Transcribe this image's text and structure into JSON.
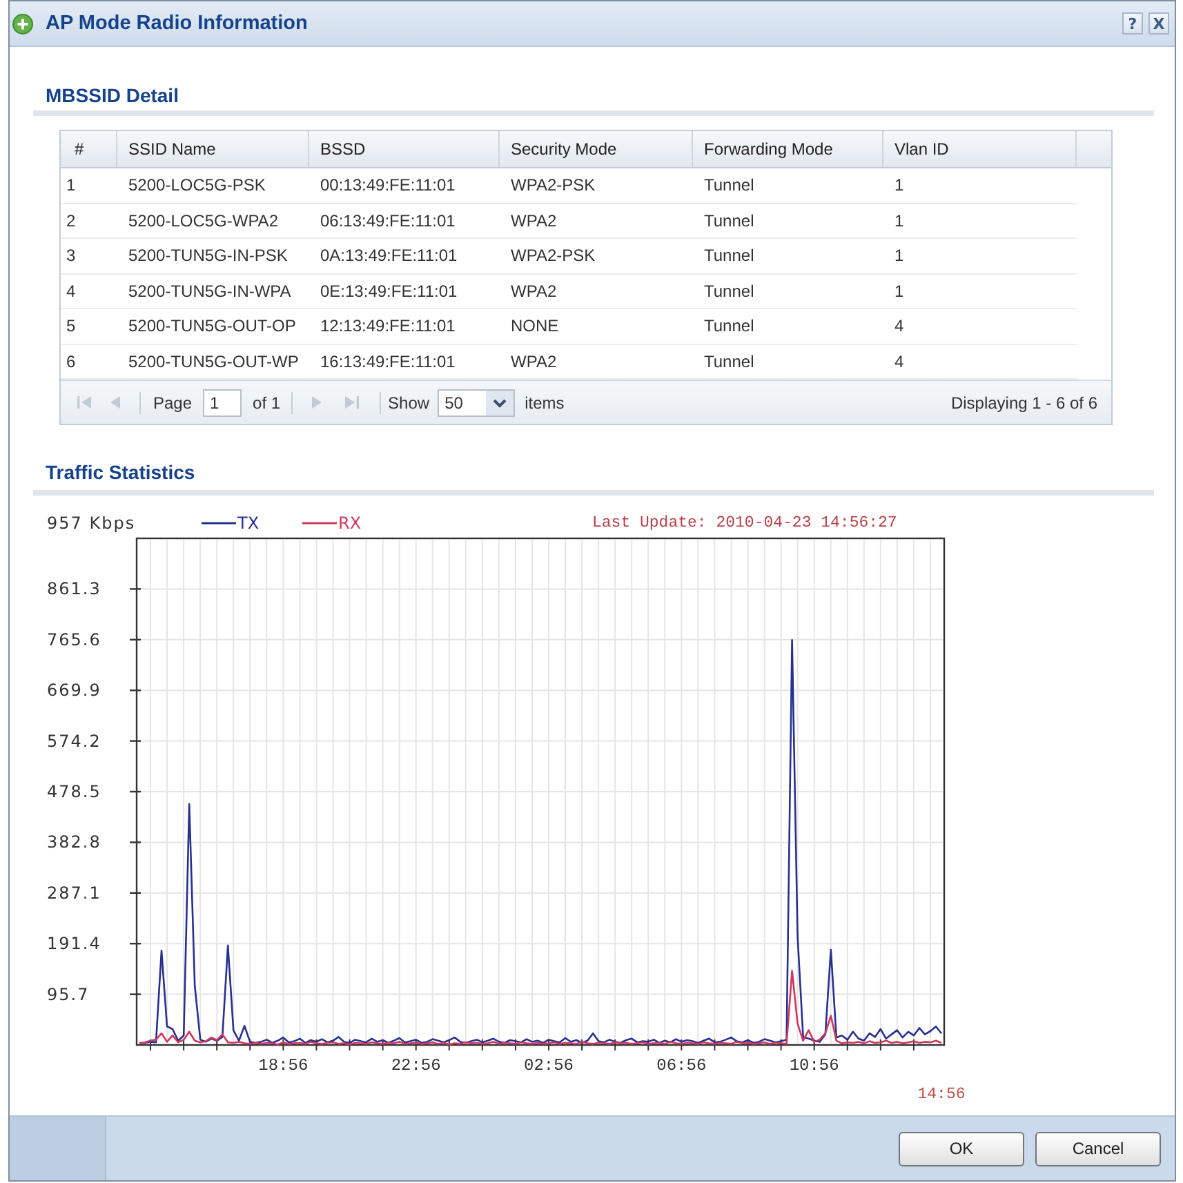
{
  "window": {
    "title": "AP Mode Radio Information",
    "tools": [
      "?",
      "X"
    ]
  },
  "mbssid": {
    "heading": "MBSSID Detail",
    "columns": [
      "#",
      "SSID Name",
      "BSSD",
      "Security Mode",
      "Forwarding Mode",
      "Vlan ID"
    ],
    "rows": [
      [
        "1",
        "5200-LOC5G-PSK",
        "00:13:49:FE:11:01",
        "WPA2-PSK",
        "Tunnel",
        "1"
      ],
      [
        "2",
        "5200-LOC5G-WPA2",
        "06:13:49:FE:11:01",
        "WPA2",
        "Tunnel",
        "1"
      ],
      [
        "3",
        "5200-TUN5G-IN-PSK",
        "0A:13:49:FE:11:01",
        "WPA2-PSK",
        "Tunnel",
        "1"
      ],
      [
        "4",
        "5200-TUN5G-IN-WPA",
        "0E:13:49:FE:11:01",
        "WPA2",
        "Tunnel",
        "1"
      ],
      [
        "5",
        "5200-TUN5G-OUT-OP",
        "12:13:49:FE:11:01",
        "NONE",
        "Tunnel",
        "4"
      ],
      [
        "6",
        "5200-TUN5G-OUT-WP",
        "16:13:49:FE:11:01",
        "WPA2",
        "Tunnel",
        "4"
      ]
    ],
    "pager": {
      "first_button": {
        "disabled": true
      },
      "prev_button": {
        "disabled": true
      },
      "page_label": "Page",
      "page_input": "1",
      "page_count": "of 1",
      "next_button": {
        "disabled": true
      },
      "last_button": {
        "disabled": true
      },
      "show_label": "Show",
      "page_size": "50",
      "items_label": "items",
      "summary": "Displaying 1 - 6 of 6"
    }
  },
  "traffic": {
    "heading": "Traffic Statistics",
    "last_update": "Last Update: 2010-04-23 14:56:27",
    "chart_data": {
      "type": "line",
      "ylabel": "957 Kbps",
      "ylim": [
        0,
        957
      ],
      "grid": true,
      "legend": "top",
      "yticks": [
        95.7,
        191.4,
        287.1,
        382.8,
        478.5,
        574.2,
        669.9,
        765.6,
        861.3
      ],
      "categories": [
        null,
        null,
        null,
        null,
        null,
        null,
        null,
        null,
        null,
        null,
        null,
        null,
        null,
        null,
        null,
        null,
        null,
        null,
        null,
        null,
        null,
        null,
        null,
        null,
        null,
        null,
        "18:56",
        null,
        null,
        null,
        null,
        null,
        null,
        null,
        null,
        null,
        null,
        null,
        null,
        null,
        null,
        null,
        null,
        null,
        null,
        null,
        null,
        null,
        null,
        null,
        "22:56",
        null,
        null,
        null,
        null,
        null,
        null,
        null,
        null,
        null,
        null,
        null,
        null,
        null,
        null,
        null,
        null,
        null,
        null,
        null,
        null,
        null,
        null,
        null,
        "02:56",
        null,
        null,
        null,
        null,
        null,
        null,
        null,
        null,
        null,
        null,
        null,
        null,
        null,
        null,
        null,
        null,
        null,
        null,
        null,
        null,
        null,
        null,
        null,
        "06:56",
        null,
        null,
        null,
        null,
        null,
        null,
        null,
        null,
        null,
        null,
        null,
        null,
        null,
        null,
        null,
        null,
        null,
        null,
        null,
        null,
        null,
        null,
        null,
        "10:56",
        null,
        null,
        null,
        null,
        null,
        null,
        null,
        null,
        null,
        null,
        null,
        null,
        null,
        null,
        null,
        null,
        null,
        null,
        null,
        null,
        null,
        null,
        null
      ],
      "annotations": [
        "14:56"
      ],
      "series": [
        {
          "name": "TX",
          "color": "#27308f",
          "values": [
            3,
            4,
            6,
            5,
            178,
            35,
            30,
            8,
            18,
            455,
            112,
            10,
            6,
            12,
            8,
            15,
            188,
            28,
            8,
            36,
            6,
            4,
            6,
            10,
            4,
            8,
            14,
            5,
            7,
            12,
            4,
            9,
            6,
            11,
            5,
            8,
            15,
            6,
            4,
            10,
            7,
            5,
            12,
            6,
            9,
            4,
            8,
            13,
            5,
            7,
            10,
            4,
            6,
            11,
            8,
            5,
            9,
            14,
            6,
            4,
            7,
            10,
            5,
            8,
            12,
            6,
            4,
            9,
            7,
            5,
            11,
            6,
            8,
            4,
            10,
            7,
            5,
            13,
            6,
            9,
            4,
            8,
            22,
            7,
            5,
            10,
            6,
            4,
            9,
            12,
            5,
            7,
            6,
            10,
            4,
            8,
            5,
            11,
            6,
            9,
            7,
            4,
            8,
            12,
            5,
            6,
            10,
            14,
            7,
            5,
            9,
            4,
            6,
            11,
            8,
            5,
            7,
            10,
            765,
            205,
            15,
            12,
            8,
            6,
            20,
            180,
            14,
            18,
            10,
            25,
            12,
            8,
            22,
            15,
            30,
            12,
            20,
            28,
            14,
            25,
            18,
            32,
            20,
            26,
            35,
            22
          ]
        },
        {
          "name": "RX",
          "color": "#d0365f",
          "values": [
            3,
            5,
            8,
            10,
            22,
            6,
            18,
            5,
            10,
            25,
            8,
            5,
            7,
            14,
            9,
            20,
            5,
            4,
            6,
            3,
            2,
            4,
            2,
            4,
            3,
            1,
            5,
            2,
            3,
            4,
            2,
            6,
            3,
            2,
            4,
            5,
            2,
            3,
            1,
            4,
            3,
            2,
            5,
            3,
            2,
            4,
            3,
            6,
            2,
            3,
            4,
            2,
            3,
            5,
            2,
            4,
            1,
            3,
            2,
            5,
            3,
            4,
            2,
            3,
            6,
            2,
            4,
            3,
            2,
            5,
            3,
            2,
            4,
            2,
            3,
            5,
            2,
            4,
            3,
            2,
            6,
            3,
            2,
            4,
            3,
            2,
            5,
            3,
            4,
            2,
            3,
            5,
            2,
            3,
            4,
            2,
            6,
            3,
            2,
            4,
            3,
            2,
            5,
            3,
            2,
            4,
            3,
            2,
            6,
            3,
            4,
            2,
            3,
            5,
            2,
            4,
            3,
            2,
            140,
            40,
            8,
            28,
            6,
            10,
            22,
            55,
            8,
            3,
            5,
            4,
            6,
            3,
            7,
            4,
            5,
            8,
            4,
            6,
            3,
            5,
            7,
            4,
            6,
            5,
            8,
            4
          ]
        }
      ]
    }
  },
  "buttons": [
    "OK",
    "Cancel"
  ]
}
